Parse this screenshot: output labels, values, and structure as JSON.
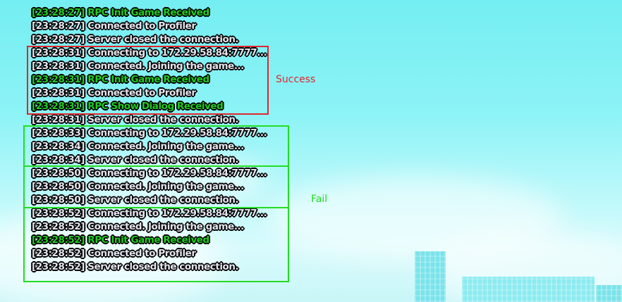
{
  "log": {
    "lines": [
      {
        "time": "[23:28:27]",
        "text": "RPC Init Game Received",
        "kind": "rpc"
      },
      {
        "time": "[23:28:27]",
        "text": "Connected to Profiler",
        "kind": "info"
      },
      {
        "time": "[23:28:27]",
        "text": "Server closed the connection.",
        "kind": "info"
      },
      {
        "time": "[23:28:31]",
        "text": "Connecting to 172.29.58.84:7777...",
        "kind": "info"
      },
      {
        "time": "[23:28:31]",
        "text": "Connected. Joining the game...",
        "kind": "info"
      },
      {
        "time": "[23:28:31]",
        "text": "RPC Init Game Received",
        "kind": "rpc"
      },
      {
        "time": "[23:28:31]",
        "text": "Connected to Profiler",
        "kind": "info"
      },
      {
        "time": "[23:28:31]",
        "text": "RPC Show Dialog Received",
        "kind": "rpc"
      },
      {
        "time": "[23:28:31]",
        "text": "Server closed the connection.",
        "kind": "info"
      },
      {
        "time": "[23:28:33]",
        "text": "Connecting to 172.29.58.84:7777...",
        "kind": "info"
      },
      {
        "time": "[23:28:34]",
        "text": "Connected. Joining the game...",
        "kind": "info"
      },
      {
        "time": "[23:28:34]",
        "text": "Server closed the connection.",
        "kind": "info"
      },
      {
        "time": "[23:28:50]",
        "text": "Connecting to 172.29.58.84:7777...",
        "kind": "info"
      },
      {
        "time": "[23:28:50]",
        "text": "Connected. Joining the game...",
        "kind": "info"
      },
      {
        "time": "[23:28:50]",
        "text": "Server closed the connection.",
        "kind": "info"
      },
      {
        "time": "[23:28:52]",
        "text": "Connecting to 172.29.58.84:7777...",
        "kind": "info"
      },
      {
        "time": "[23:28:52]",
        "text": "Connected. Joining the game...",
        "kind": "info"
      },
      {
        "time": "[23:28:52]",
        "text": "RPC Init Game Received",
        "kind": "rpc"
      },
      {
        "time": "[23:28:52]",
        "text": "Connected to Profiler",
        "kind": "info"
      },
      {
        "time": "[23:28:52]",
        "text": "Server closed the connection.",
        "kind": "info"
      }
    ]
  },
  "annotations": {
    "success_label": "Success",
    "fail_label": "Fail"
  },
  "colors": {
    "success": "#e0262c",
    "fail": "#22dd22",
    "rpc_text": "#1fcc1f",
    "log_text": "#e4e4ee",
    "sky": "#8df3f6"
  }
}
